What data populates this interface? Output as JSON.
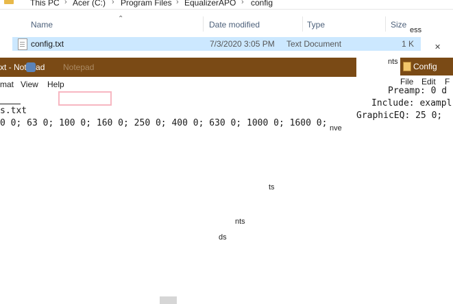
{
  "explorer": {
    "breadcrumb": [
      "This PC",
      "Acer (C:)",
      "Program Files",
      "EqualizerAPO",
      "config"
    ],
    "columns": {
      "name": "Name",
      "date_modified": "Date modified",
      "type": "Type",
      "size": "Size"
    },
    "rows": [
      {
        "name": "config.txt",
        "date": "7/3/2020 3:05 PM",
        "type": "Text Document",
        "size": "1 K"
      }
    ],
    "side_label_top": "ess",
    "side_label_mid": "nts",
    "close_glyph": "✕",
    "side_words": [
      "ds",
      "nve",
      "ts",
      "nts",
      "ds"
    ]
  },
  "notepad_main": {
    "title": "xt - Notepad",
    "ghost_label": "Notepad",
    "menu": [
      "mat",
      "View",
      "Help"
    ],
    "lines": [
      "s.txt",
      "0 0; 63 0; 100 0; 160 0; 250 0; 400 0; 630 0; 1000 0; 1600 0;"
    ]
  },
  "notepad_side": {
    "title": "Config",
    "menu": [
      "File",
      "Edit",
      "F"
    ],
    "lines": [
      "Preamp: 0 d",
      "Include: exampl",
      "GraphicEQ: 25 0;"
    ]
  }
}
